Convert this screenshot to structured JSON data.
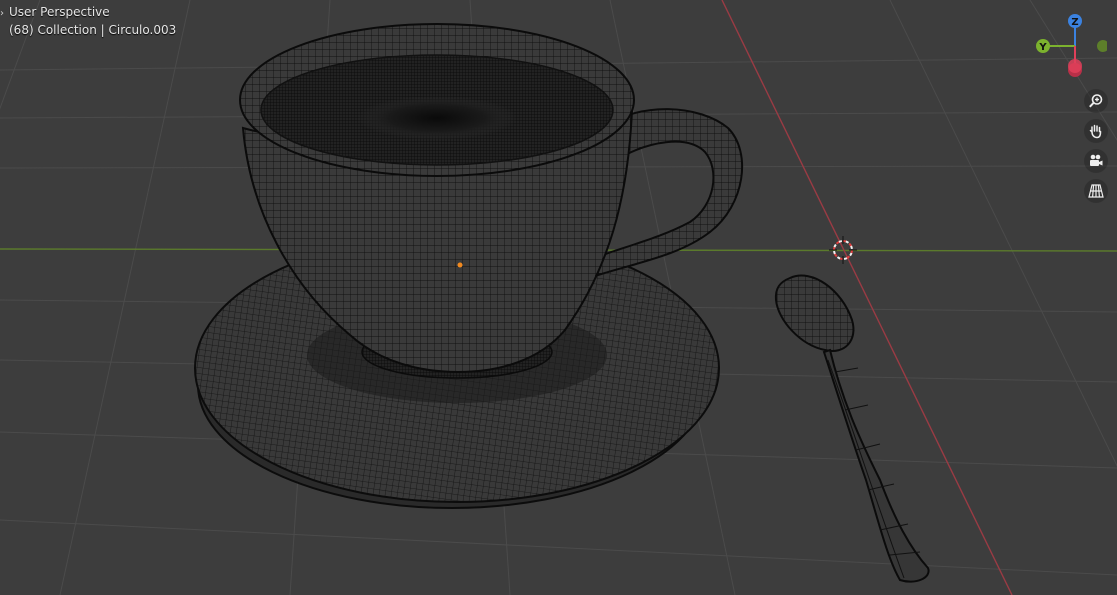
{
  "viewport": {
    "view_name": "User Perspective",
    "collection_info": "(68) Collection | Circulo.003"
  },
  "gizmo": {
    "z_label": "Z",
    "y_label": "Y",
    "x_color": "#e0405a",
    "y_color": "#7cb22e",
    "z_color": "#3b82e0"
  },
  "navigation": {
    "icons": [
      "zoom-icon",
      "pan-hand-icon",
      "camera-view-icon",
      "perspective-grid-icon"
    ]
  },
  "colors": {
    "background": "#3d3d3d",
    "grid": "#4a4a4a",
    "x_axis_line": "#9a3b44",
    "y_axis_line": "#5b7a2c",
    "wire": "#0d0d0d",
    "origin_dot": "#f28a1f",
    "cursor": "#e04040"
  }
}
